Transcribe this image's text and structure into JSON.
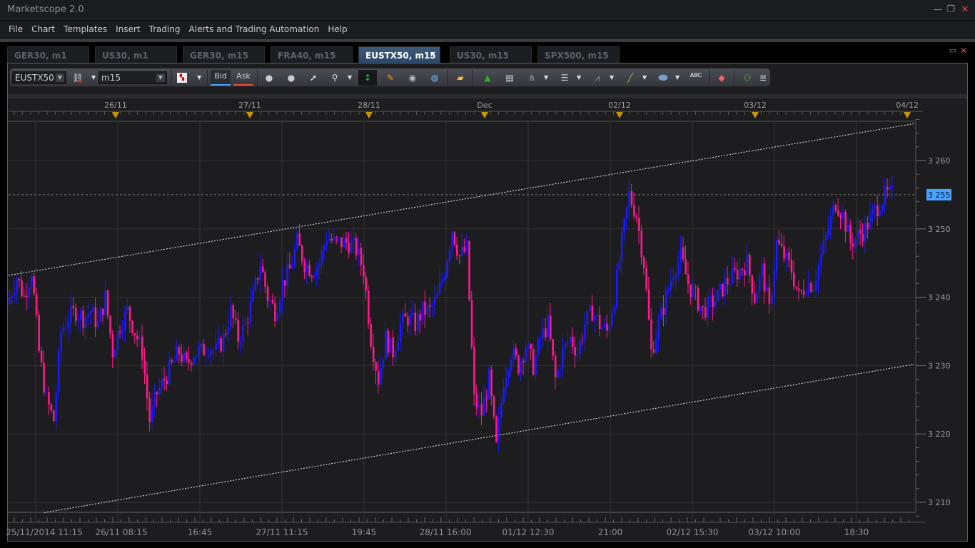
{
  "app": {
    "title": "Marketscope 2.0"
  },
  "menu": [
    "File",
    "Chart",
    "Templates",
    "Insert",
    "Trading",
    "Alerts and Trading Automation",
    "Help"
  ],
  "tabs": [
    {
      "label": "GER30, m1",
      "active": false
    },
    {
      "label": "US30, m1",
      "active": false
    },
    {
      "label": "GER30, m15",
      "active": false
    },
    {
      "label": "FRA40, m15",
      "active": false
    },
    {
      "label": "EUSTX50, m15",
      "active": true
    },
    {
      "label": "US30, m15",
      "active": false
    },
    {
      "label": "SPX500, m15",
      "active": false
    }
  ],
  "toolbar": {
    "instrument": "EUSTX50",
    "timeframe": "m15",
    "bid_label": "Bid",
    "ask_label": "Ask",
    "abc_label": "ABC"
  },
  "colors": {
    "up": "#1a1aff",
    "down": "#ff1a8c",
    "price_tag": "#4aa3ff",
    "bid": "#4aa3ff",
    "ask": "#e8503a"
  },
  "chart_data": {
    "type": "candlestick",
    "instrument": "EUSTX50",
    "timeframe": "m15",
    "ylim": [
      3208,
      3266
    ],
    "yticks": [
      3260,
      3250,
      3240,
      3230,
      3220,
      3210
    ],
    "ytick_labels": [
      "3 260",
      "3 250",
      "3 240",
      "3 230",
      "3 220",
      "3 210"
    ],
    "current_price": 3255,
    "current_price_label": "3 255",
    "top_date_labels": [
      "26/11",
      "27/11",
      "28/11",
      "Dec",
      "02/12",
      "03/12",
      "04/12"
    ],
    "bottom_time_labels": [
      "25/11/2014 11:15",
      "26/11 08:15",
      "16:45",
      "27/11 11:15",
      "19:45",
      "28/11 16:00",
      "01/12 12:30",
      "21:00",
      "02/12 15:30",
      "03/12 10:00",
      "18:30"
    ],
    "closes": [
      3240,
      3243,
      3240,
      3244,
      3232,
      3225,
      3222,
      3235,
      3237,
      3238,
      3237,
      3238,
      3236,
      3240,
      3232,
      3236,
      3238,
      3235,
      3232,
      3222,
      3226,
      3228,
      3230,
      3232,
      3230,
      3232,
      3232,
      3233,
      3232,
      3234,
      3238,
      3234,
      3236,
      3240,
      3245,
      3240,
      3238,
      3242,
      3244,
      3248,
      3245,
      3244,
      3245,
      3249,
      3248,
      3248,
      3248,
      3247,
      3244,
      3234,
      3228,
      3234,
      3232,
      3236,
      3237,
      3236,
      3238,
      3238,
      3240,
      3244,
      3250,
      3246,
      3247,
      3225,
      3223,
      3228,
      3218,
      3228,
      3232,
      3230,
      3233,
      3230,
      3234,
      3236,
      3228,
      3232,
      3234,
      3232,
      3236,
      3238,
      3236,
      3235,
      3240,
      3248,
      3255,
      3252,
      3245,
      3232,
      3236,
      3240,
      3244,
      3246,
      3242,
      3240,
      3238,
      3239,
      3240,
      3242,
      3243,
      3244,
      3245,
      3240,
      3244,
      3238,
      3248,
      3246,
      3244,
      3240,
      3242,
      3242,
      3246,
      3250,
      3254,
      3252,
      3248,
      3249,
      3250,
      3252,
      3254,
      3255
    ],
    "trendlines": [
      {
        "name": "upper-channel",
        "start_price": 3243.2,
        "end_price": 3265.4
      },
      {
        "name": "lower-channel",
        "start_price": 3208.5,
        "end_price": 3230.2
      }
    ]
  }
}
